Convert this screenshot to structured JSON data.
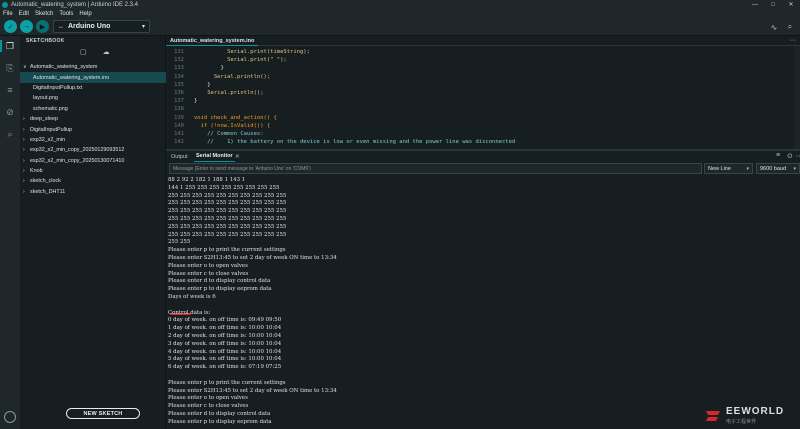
{
  "window": {
    "title": "Automatic_watering_system | Arduino IDE 2.3.4",
    "controls": [
      "—",
      "□",
      "✕"
    ]
  },
  "menu": [
    "File",
    "Edit",
    "Sketch",
    "Tools",
    "Help"
  ],
  "toolbar": {
    "verify_icon": "✓",
    "upload_icon": "→",
    "debug_icon": "▶",
    "board": "Arduino Uno",
    "usb_icon": "↔",
    "caret": "▾",
    "serial_plotter_icon": "∿",
    "serial_monitor_icon": "⌕"
  },
  "sidebar": {
    "title": "SKETCHBOOK",
    "icons": [
      "▢",
      "☁"
    ],
    "items": [
      {
        "kind": "folder",
        "label": "Automatic_watering_system",
        "chev": "∨",
        "selected": false
      },
      {
        "kind": "file",
        "label": "Automatic_watering_system.ino",
        "selected": true
      },
      {
        "kind": "file",
        "label": "DigitalInputPullup.txt",
        "selected": false
      },
      {
        "kind": "file",
        "label": "layout.png",
        "selected": false
      },
      {
        "kind": "file",
        "label": "schematic.png",
        "selected": false
      },
      {
        "kind": "folder",
        "label": "deep_sleep",
        "chev": "›",
        "selected": false
      },
      {
        "kind": "folder",
        "label": "DigitalInputPullup",
        "chev": "›",
        "selected": false
      },
      {
        "kind": "folder",
        "label": "esp32_s2_min",
        "chev": "›",
        "selected": false
      },
      {
        "kind": "folder",
        "label": "esp32_s2_min_copy_20250129093512",
        "chev": "›",
        "selected": false
      },
      {
        "kind": "folder",
        "label": "esp32_s2_min_copy_20250130071410",
        "chev": "›",
        "selected": false
      },
      {
        "kind": "folder",
        "label": "Knob",
        "chev": "›",
        "selected": false
      },
      {
        "kind": "folder",
        "label": "sketch_clock",
        "chev": "›",
        "selected": false
      },
      {
        "kind": "folder",
        "label": "sketch_DHT11",
        "chev": "›",
        "selected": false
      }
    ],
    "new_sketch": "NEW SKETCH"
  },
  "editor": {
    "tab": "Automatic_watering_system.ino",
    "more": "⋯",
    "lines": [
      {
        "n": "131",
        "text": "          Serial.print(timeString);",
        "style": "call"
      },
      {
        "n": "132",
        "text": "          Serial.print(\" \");",
        "style": "call"
      },
      {
        "n": "133",
        "text": "        }",
        "style": "plain"
      },
      {
        "n": "134",
        "text": "      Serial.println();",
        "style": "call"
      },
      {
        "n": "135",
        "text": "    }",
        "style": "plain"
      },
      {
        "n": "136",
        "text": "    Serial.println();",
        "style": "call"
      },
      {
        "n": "137",
        "text": "}",
        "style": "plain"
      },
      {
        "n": "138",
        "text": "",
        "style": "plain"
      },
      {
        "n": "139",
        "text": "void check_and_action() {",
        "style": "keyword"
      },
      {
        "n": "140",
        "text": "  if (!now.IsValid()) {",
        "style": "keyword"
      },
      {
        "n": "141",
        "text": "    // Common Causes:",
        "style": "comment"
      },
      {
        "n": "142",
        "text": "    //    1) the battery on the device is low or even missing and the power line was disconnected",
        "style": "comment"
      }
    ]
  },
  "panel": {
    "tabs": [
      "Output",
      "Serial Monitor"
    ],
    "close_icon": "✕",
    "icons": [
      "≡",
      "⊙",
      "⋯"
    ],
    "input_placeholder": "Message (Enter to send message to 'Arduino Uno' on 'COM6')",
    "line_ending": "New Line",
    "baud": "9600 baud"
  },
  "monitor": {
    "lines": [
      "88 2 92 2 182 1 188 1 143 1",
      "144 1 255 255 255 255 255 255 255 255",
      "255 255 255 255 255 255 255 255 255 255",
      "255 255 255 255 255 255 255 255 255 255",
      "255 255 255 255 255 255 255 255 255 255",
      "255 255 255 255 255 255 255 255 255 255",
      "255 255 255 255 255 255 255 255 255 255",
      "255 255 255 255 255 255 255 255 255 255",
      "255 255",
      "Please enter p to print the current settings",
      "Please enter S2H13:45 to set 2 day of week ON time to 13:34",
      "Please enter o to open valves",
      "Please enter c to close valves",
      "Please enter d to display control data",
      "Please enter p to display eeprom data",
      "Days of week is 6",
      "",
      "Control data is:",
      "0 day of week. on off time is: 09:49 09:50",
      "1 day of week. on off time is: 10:00 10:04",
      "2 day of week. on off time is: 10:00 10:04",
      "3 day of week. on off time is: 10:00 10:04",
      "4 day of week. on off time is: 10:00 10:04",
      "5 day of week. on off time is: 10:00 10:04",
      "6 day of week. on off time is: 07:19 07:25",
      "",
      "Please enter p to print the current settings",
      "Please enter S2H13:45 to set 2 day of week ON time to 13:34",
      "Please enter o to open valves",
      "Please enter c to close valves",
      "Please enter d to display control data",
      "Please enter p to display eeprom data"
    ]
  },
  "watermark": {
    "text": "EEWORLD",
    "sub": "电子工程世界",
    "color": "#d9262c"
  },
  "activity_icons": [
    "❐",
    "⎘",
    "≡",
    "⊘",
    "⌕"
  ],
  "colors": {
    "accent": "#00979d",
    "background": "#171e21",
    "chrome": "#1f272a",
    "selection": "#164a4f"
  }
}
